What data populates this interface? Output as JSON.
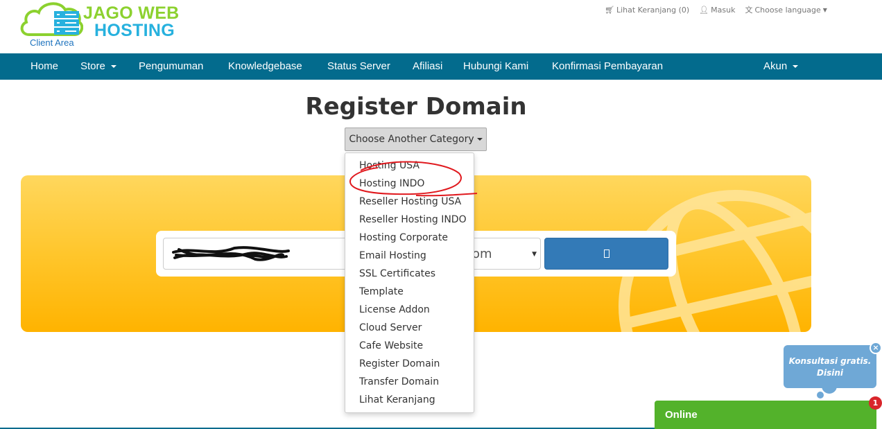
{
  "brand": {
    "line1": "JAGO WEB",
    "line2": "HOSTING",
    "sub": "Client Area",
    "colors": {
      "green": "#8cd12f",
      "blue": "#27b1de"
    }
  },
  "toplinks": {
    "cart": "Lihat Keranjang (0)",
    "login": "Masuk",
    "language": "Choose language"
  },
  "nav": {
    "items": [
      "Home",
      "Store",
      "Pengumuman",
      "Knowledgebase",
      "Status Server",
      "Afiliasi",
      "Hubungi Kami",
      "Konfirmasi Pembayaran"
    ],
    "account": "Akun",
    "color": "#036b8d"
  },
  "page": {
    "title": "Register Domain",
    "category_button": "Choose Another Category"
  },
  "search": {
    "tld_value": "om",
    "button_icon": "search-icon"
  },
  "dropdown": {
    "items": [
      "Hosting USA",
      "Hosting INDO",
      "Reseller Hosting USA",
      "Reseller Hosting INDO",
      "Hosting Corporate",
      "Email Hosting",
      "SSL Certificates",
      "Template",
      "License Addon",
      "Cloud Server",
      "Cafe Website",
      "Register Domain",
      "Transfer Domain",
      "Lihat Keranjang"
    ],
    "highlighted": "Hosting INDO"
  },
  "chat": {
    "bubble_line1": "Konsultasi gratis.",
    "bubble_line2": "Disini",
    "close": "×",
    "status": "Online",
    "badge_count": "1"
  }
}
